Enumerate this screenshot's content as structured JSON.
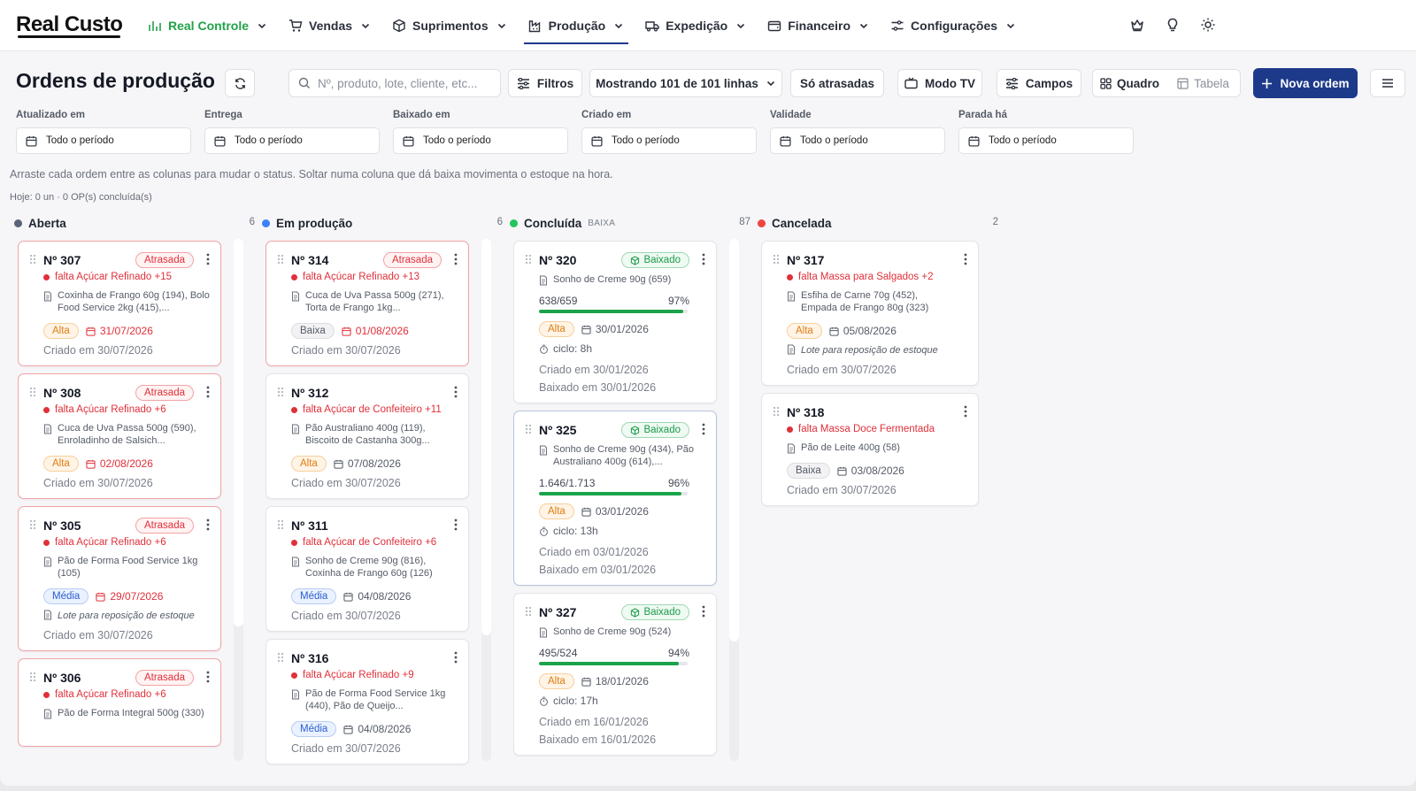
{
  "app": {
    "logo": "Real Custo"
  },
  "nav": [
    {
      "label": "Real Controle",
      "icon": "bar-chart-icon"
    },
    {
      "label": "Vendas",
      "icon": "cart-icon"
    },
    {
      "label": "Suprimentos",
      "icon": "box-icon"
    },
    {
      "label": "Produção",
      "icon": "factory-icon"
    },
    {
      "label": "Expedição",
      "icon": "truck-icon"
    },
    {
      "label": "Financeiro",
      "icon": "wallet-icon"
    },
    {
      "label": "Configurações",
      "icon": "settings-icon"
    }
  ],
  "nav_active": "Produção",
  "page": {
    "title": "Ordens de produção"
  },
  "toolbar": {
    "search_placeholder": "Nº, produto, lote, cliente, etc...",
    "filtros": "Filtros",
    "showing": "Mostrando 101 de 101 linhas",
    "late_only": "Só atrasadas",
    "tv_mode": "Modo TV",
    "fields": "Campos",
    "view_board": "Quadro",
    "view_table": "Tabela",
    "new_order": "Nova ordem"
  },
  "filters": [
    {
      "label": "Atualizado em",
      "value": "Todo o período"
    },
    {
      "label": "Entrega",
      "value": "Todo o período"
    },
    {
      "label": "Baixado em",
      "value": "Todo o período"
    },
    {
      "label": "Criado em",
      "value": "Todo o período"
    },
    {
      "label": "Validade",
      "value": "Todo o período"
    },
    {
      "label": "Parada há",
      "value": "Todo o período"
    }
  ],
  "hint": "Arraste cada ordem entre as colunas para mudar o status. Soltar numa coluna que dá baixa movimenta o estoque na hora.",
  "today": "Hoje: 0 un · 0 OP(s) concluída(s)",
  "colors": {
    "primary": "#1d3a8a",
    "green": "#22a24a",
    "red": "#e0303a",
    "orange": "#e07d12",
    "blue": "#2a5fd0"
  },
  "columns": [
    {
      "title": "Aberta",
      "tag": "",
      "count": "6",
      "dot": "#5b6478"
    },
    {
      "title": "Em produção",
      "tag": "",
      "count": "6",
      "dot": "#3b82f6"
    },
    {
      "title": "Concluída",
      "tag": "BAIXA",
      "count": "87",
      "dot": "#22c55e"
    },
    {
      "title": "Cancelada",
      "tag": "",
      "count": "2",
      "dot": "#ef4444"
    }
  ],
  "col_open": [
    {
      "num": "Nº 307",
      "badge": "Atrasada",
      "missing": "falta Açúcar Refinado +15",
      "items": "Coxinha de Frango 60g (194), Bolo Food Service 2kg (415),...",
      "priority": "Alta",
      "due": "31/07/2026",
      "created": "Criado em 30/07/2026"
    },
    {
      "num": "Nº 308",
      "badge": "Atrasada",
      "missing": "falta Açúcar Refinado +6",
      "items": "Cuca de Uva Passa 500g (590), Enroladinho de Salsich...",
      "priority": "Alta",
      "due": "02/08/2026",
      "created": "Criado em 30/07/2026"
    },
    {
      "num": "Nº 305",
      "badge": "Atrasada",
      "missing": "falta Açúcar Refinado +6",
      "items": "Pão de Forma Food Service 1kg (105)",
      "priority": "Média",
      "due": "29/07/2026",
      "note": "Lote para reposição de estoque",
      "created": "Criado em 30/07/2026"
    },
    {
      "num": "Nº 306",
      "badge": "Atrasada",
      "missing": "falta Açúcar Refinado +6",
      "items": "Pão de Forma Integral 500g (330)"
    }
  ],
  "col_prod": [
    {
      "num": "Nº 314",
      "badge": "Atrasada",
      "missing": "falta Açúcar Refinado +13",
      "items": "Cuca de Uva Passa 500g (271), Torta de Frango 1kg...",
      "priority": "Baixa",
      "due": "01/08/2026",
      "created": "Criado em 30/07/2026"
    },
    {
      "num": "Nº 312",
      "missing": "falta Açúcar de Confeiteiro +11",
      "items": "Pão Australiano 400g (119), Biscoito de Castanha 300g...",
      "priority": "Alta",
      "due": "07/08/2026",
      "created": "Criado em 30/07/2026"
    },
    {
      "num": "Nº 311",
      "missing": "falta Açúcar de Confeiteiro +6",
      "items": "Sonho de Creme 90g (816), Coxinha de Frango 60g (126)",
      "priority": "Média",
      "due": "04/08/2026",
      "created": "Criado em 30/07/2026"
    },
    {
      "num": "Nº 316",
      "missing": "falta Açúcar Refinado +9",
      "items": "Pão de Forma Food Service 1kg (440), Pão de Queijo...",
      "priority": "Média",
      "due": "04/08/2026",
      "created": "Criado em 30/07/2026"
    }
  ],
  "col_done": [
    {
      "num": "Nº 320",
      "badge": "Baixado",
      "items": "Sonho de Creme 90g (659)",
      "progress_label": "638/659",
      "progress_pct": "97%",
      "progress": 0.97,
      "priority": "Alta",
      "due": "30/01/2026",
      "cycle": "ciclo: 8h",
      "created": "Criado em 30/01/2026",
      "closed": "Baixado em 30/01/2026"
    },
    {
      "num": "Nº 325",
      "badge": "Baixado",
      "items": "Sonho de Creme 90g (434), Pão Australiano 400g (614),...",
      "progress_label": "1.646/1.713",
      "progress_pct": "96%",
      "progress": 0.96,
      "priority": "Alta",
      "due": "03/01/2026",
      "cycle": "ciclo: 13h",
      "created": "Criado em 03/01/2026",
      "closed": "Baixado em 03/01/2026"
    },
    {
      "num": "Nº 327",
      "badge": "Baixado",
      "items": "Sonho de Creme 90g (524)",
      "progress_label": "495/524",
      "progress_pct": "94%",
      "progress": 0.94,
      "priority": "Alta",
      "due": "18/01/2026",
      "cycle": "ciclo: 17h",
      "created": "Criado em 16/01/2026",
      "closed": "Baixado em 16/01/2026"
    }
  ],
  "col_cancel": [
    {
      "num": "Nº 317",
      "missing": "falta Massa para Salgados +2",
      "items": "Esfiha de Carne 70g (452), Empada de Frango 80g (323)",
      "priority": "Alta",
      "due": "05/08/2026",
      "note": "Lote para reposição de estoque",
      "created": "Criado em 30/07/2026"
    },
    {
      "num": "Nº 318",
      "missing": "falta Massa Doce Fermentada",
      "items": "Pão de Leite 400g (58)",
      "priority": "Baixa",
      "due": "03/08/2026",
      "created": "Criado em 30/07/2026"
    }
  ]
}
